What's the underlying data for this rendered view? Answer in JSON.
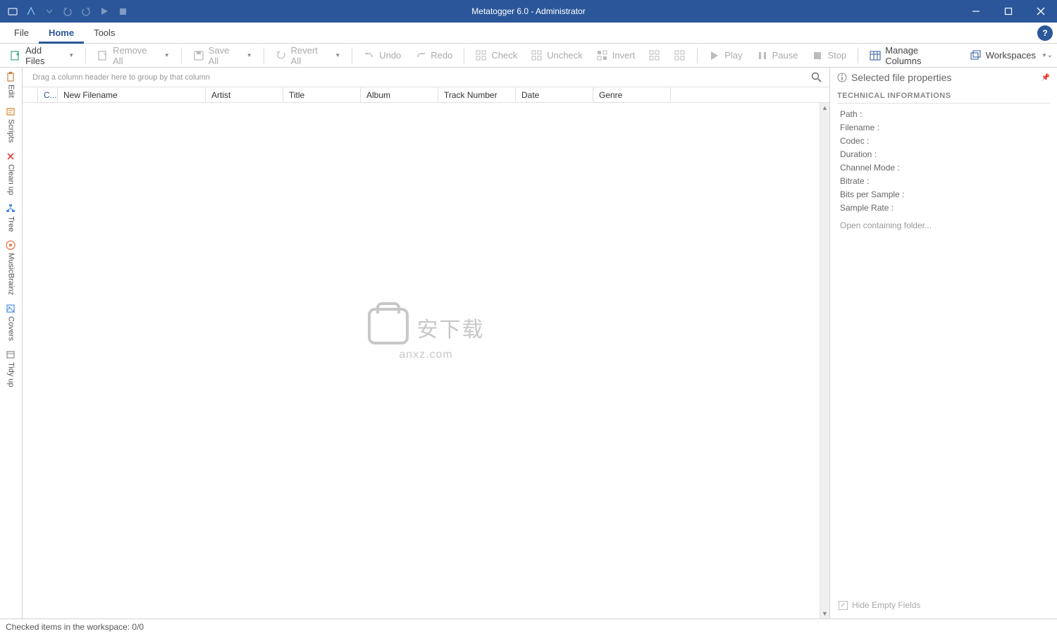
{
  "window": {
    "title": "Metatogger 6.0 - Administrator"
  },
  "menu": {
    "file": "File",
    "home": "Home",
    "tools": "Tools"
  },
  "ribbon": {
    "add_files": "Add Files",
    "remove_all": "Remove All",
    "save_all": "Save All",
    "revert_all": "Revert All",
    "undo": "Undo",
    "redo": "Redo",
    "check": "Check",
    "uncheck": "Uncheck",
    "invert": "Invert",
    "play": "Play",
    "pause": "Pause",
    "stop": "Stop",
    "manage_columns": "Manage Columns",
    "workspaces": "Workspaces"
  },
  "sidebar": {
    "items": [
      {
        "label": "Edit"
      },
      {
        "label": "Scripts"
      },
      {
        "label": "Clean up"
      },
      {
        "label": "Tree"
      },
      {
        "label": "MusicBrainz"
      },
      {
        "label": "Covers"
      },
      {
        "label": "Tidy up"
      }
    ]
  },
  "groupbar": {
    "hint": "Drag a column header here to group by that column"
  },
  "columns": {
    "c1": "C...",
    "c2": "New Filename",
    "c3": "Artist",
    "c4": "Title",
    "c5": "Album",
    "c6": "Track Number",
    "c7": "Date",
    "c8": "Genre"
  },
  "watermark": {
    "main": "安下载",
    "sub": "anxz.com"
  },
  "rightpanel": {
    "title": "Selected file properties",
    "section": "TECHNICAL INFORMATIONS",
    "props": {
      "path": "Path :",
      "filename": "Filename :",
      "codec": "Codec :",
      "duration": "Duration :",
      "channel_mode": "Channel Mode :",
      "bitrate": "Bitrate :",
      "bits_per_sample": "Bits per Sample :",
      "sample_rate": "Sample Rate :"
    },
    "open_folder": "Open containing folder...",
    "hide_empty": "Hide Empty Fields"
  },
  "status": {
    "text": "Checked items in the workspace: 0/0"
  }
}
